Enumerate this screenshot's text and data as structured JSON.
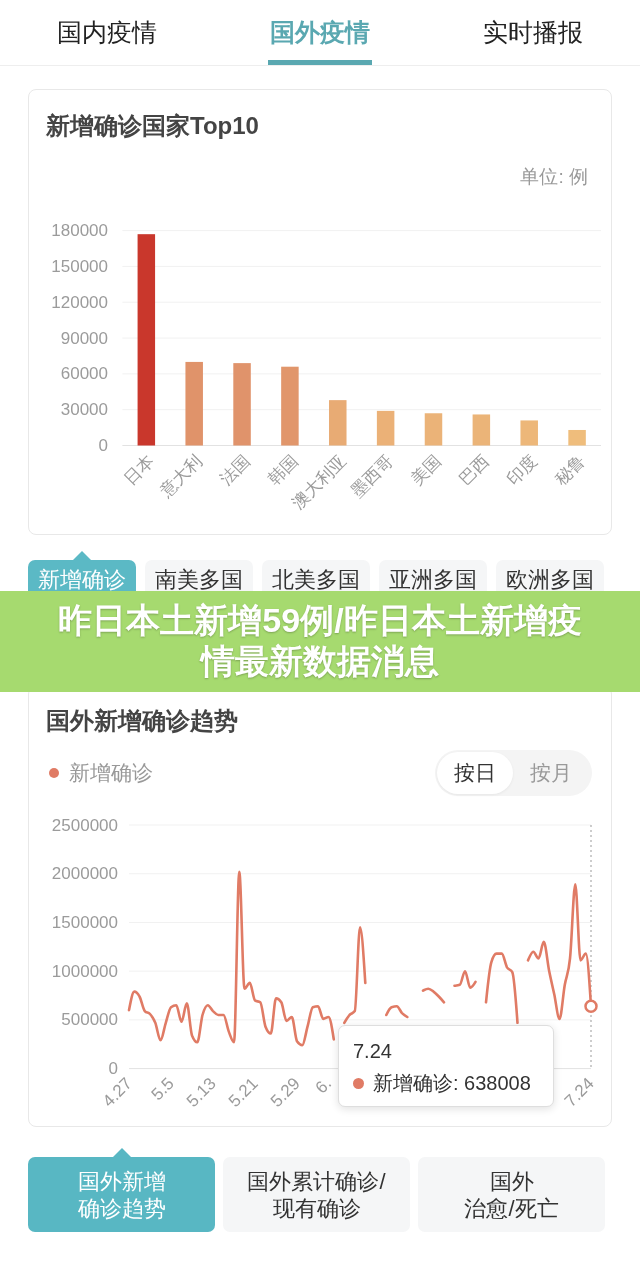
{
  "top_tabs": [
    {
      "label": "国内疫情",
      "selected": false
    },
    {
      "label": "国外疫情",
      "selected": true
    },
    {
      "label": "实时播报",
      "selected": false
    }
  ],
  "top10_card": {
    "title": "新增确诊国家Top10",
    "unit": "单位: 例",
    "chart_data": {
      "type": "bar",
      "categories": [
        "日本",
        "意大利",
        "法国",
        "韩国",
        "澳大利亚",
        "墨西哥",
        "美国",
        "巴西",
        "印度",
        "秘鲁"
      ],
      "values": [
        177000,
        70000,
        69000,
        66000,
        38000,
        29000,
        27000,
        26000,
        21000,
        13000
      ],
      "ylim": [
        0,
        180000
      ],
      "yticks": [
        0,
        30000,
        60000,
        90000,
        120000,
        150000,
        180000
      ],
      "grid": true
    }
  },
  "region_tabs": [
    {
      "label": "新增确诊",
      "selected": true
    },
    {
      "label": "南美多国",
      "selected": false
    },
    {
      "label": "北美多国",
      "selected": false
    },
    {
      "label": "亚洲多国",
      "selected": false
    },
    {
      "label": "欧洲多国",
      "selected": false
    }
  ],
  "banner": {
    "text": "昨日本土新增59例/昨日本土新增疫情最新数据消息"
  },
  "trend_card": {
    "title": "国外新增确诊趋势",
    "period_toggle": [
      {
        "label": "按日",
        "selected": true
      },
      {
        "label": "按月",
        "selected": false
      }
    ],
    "chart_data": {
      "type": "line",
      "categories": [
        "4.27",
        null,
        null,
        null,
        null,
        null,
        null,
        null,
        "5.5",
        null,
        null,
        null,
        null,
        null,
        null,
        null,
        "5.13",
        null,
        null,
        null,
        null,
        null,
        null,
        null,
        "5.21",
        null,
        null,
        null,
        null,
        null,
        null,
        null,
        "5.29",
        null,
        null,
        null,
        null,
        null,
        "6.",
        null,
        null,
        null,
        null,
        null,
        null,
        null,
        null,
        null,
        null,
        null,
        null,
        null,
        null,
        null,
        null,
        null,
        null,
        null,
        null,
        null,
        null,
        null,
        null,
        null,
        null,
        null,
        null,
        null,
        null,
        null,
        null,
        null,
        null,
        null,
        null,
        null,
        null,
        null,
        null,
        null,
        null,
        null,
        null,
        null,
        null,
        null,
        null,
        null,
        "7.24"
      ],
      "series": [
        {
          "name": "新增确诊",
          "color": "#e07b65",
          "values": [
            600000,
            790000,
            740000,
            590000,
            560000,
            470000,
            290000,
            470000,
            630000,
            650000,
            480000,
            670000,
            340000,
            270000,
            550000,
            650000,
            590000,
            550000,
            550000,
            380000,
            270000,
            2020000,
            820000,
            880000,
            700000,
            680000,
            430000,
            360000,
            720000,
            680000,
            490000,
            530000,
            280000,
            240000,
            430000,
            630000,
            640000,
            510000,
            530000,
            300000,
            null,
            470000,
            550000,
            590000,
            1450000,
            880000,
            null,
            null,
            null,
            550000,
            630000,
            640000,
            570000,
            530000,
            null,
            null,
            800000,
            820000,
            790000,
            740000,
            680000,
            null,
            850000,
            860000,
            1000000,
            830000,
            890000,
            null,
            680000,
            1090000,
            1180000,
            1180000,
            1040000,
            990000,
            470000,
            null,
            1110000,
            1200000,
            1130000,
            1300000,
            1010000,
            760000,
            510000,
            860000,
            1130000,
            1890000,
            1110000,
            1180000,
            640000
          ]
        }
      ],
      "ylim": [
        0,
        2500000
      ],
      "yticks": [
        0,
        500000,
        1000000,
        1500000,
        2000000,
        2500000
      ],
      "grid": true
    },
    "tooltip": {
      "title": "7.24",
      "text": "新增确诊: 638008"
    }
  },
  "bottom_tabs": [
    {
      "lines": [
        "国外新增",
        "确诊趋势"
      ],
      "selected": true
    },
    {
      "lines": [
        "国外累计确诊/",
        "现有确诊"
      ],
      "selected": false
    },
    {
      "lines": [
        "国外",
        "治愈/死亡"
      ],
      "selected": false
    }
  ]
}
